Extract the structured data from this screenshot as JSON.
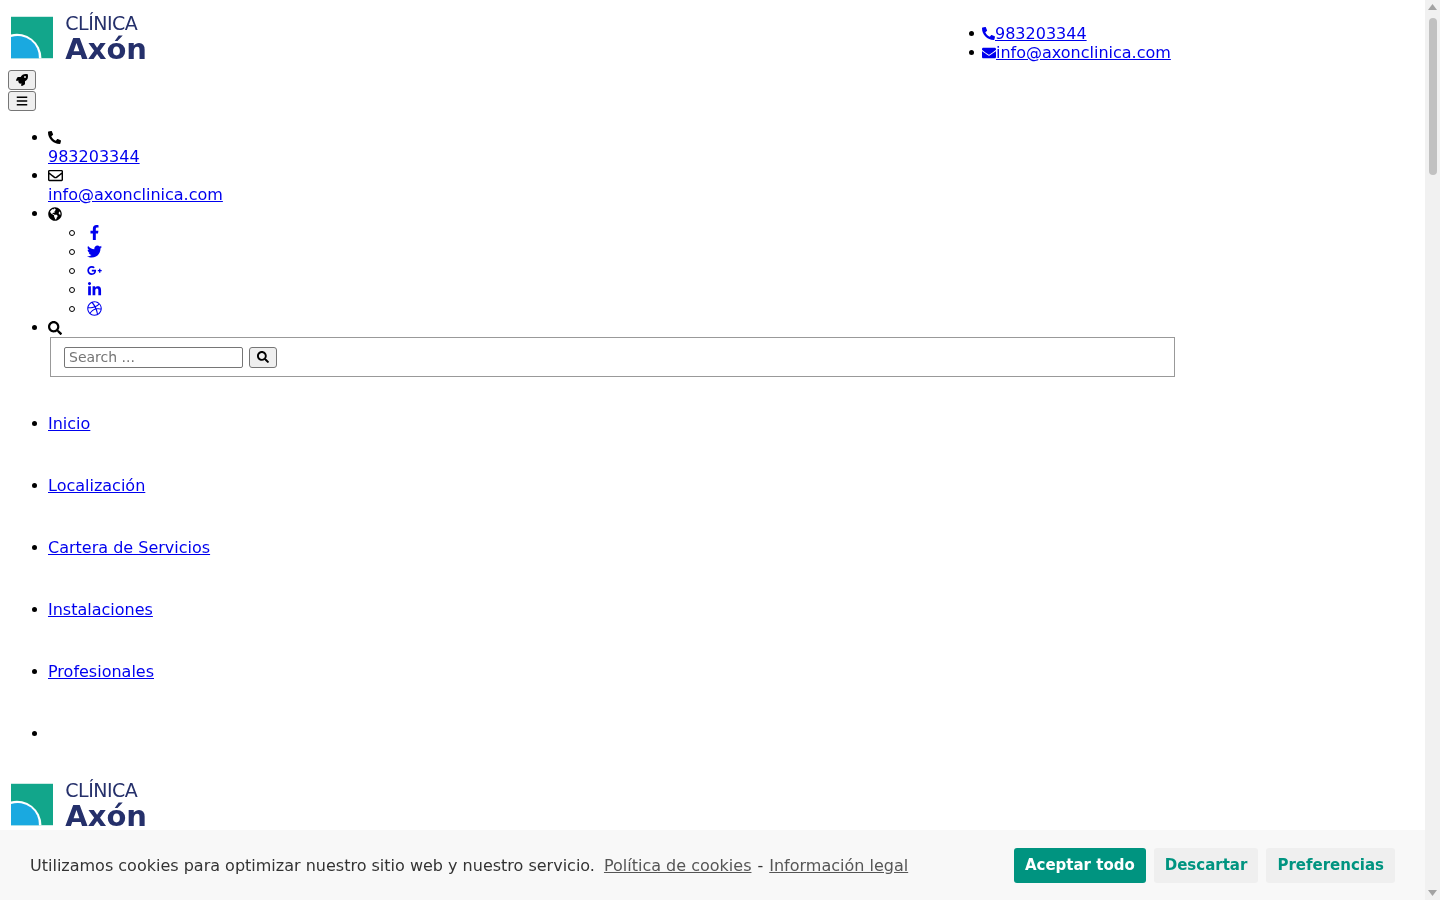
{
  "logo": {
    "line1": "CLÍNICA",
    "line2": "Axón"
  },
  "header_contacts": [
    {
      "kind": "phone",
      "text": "983203344"
    },
    {
      "kind": "email",
      "text": "info@axonclinica.com"
    }
  ],
  "toolbar_buttons": [
    {
      "kind": "rocket"
    },
    {
      "kind": "menu"
    }
  ],
  "top_bar": {
    "contacts": [
      {
        "kind": "phone",
        "text": "983203344"
      },
      {
        "kind": "email",
        "text": "info@axonclinica.com"
      }
    ],
    "social": [
      {
        "kind": "facebook"
      },
      {
        "kind": "twitter"
      },
      {
        "kind": "googleplus"
      },
      {
        "kind": "linkedin"
      },
      {
        "kind": "dribbble"
      }
    ],
    "search": {
      "placeholder": "Search ..."
    }
  },
  "nav": [
    {
      "label": "Inicio"
    },
    {
      "label": "Localización"
    },
    {
      "label": "Cartera de Servicios"
    },
    {
      "label": "Instalaciones"
    },
    {
      "label": "Profesionales"
    }
  ],
  "footer_logo": {
    "line1": "CLÍNICA",
    "line2": "Axón"
  },
  "cookie_banner": {
    "message": "Utilizamos cookies para optimizar nuestro sitio web y nuestro servicio.",
    "links": [
      "Política de cookies",
      "Información legal"
    ],
    "separator": "-",
    "buttons": [
      {
        "label": "Aceptar todo",
        "kind": "primary"
      },
      {
        "label": "Descartar",
        "kind": "secondary"
      },
      {
        "label": "Preferencias",
        "kind": "secondary"
      }
    ]
  }
}
